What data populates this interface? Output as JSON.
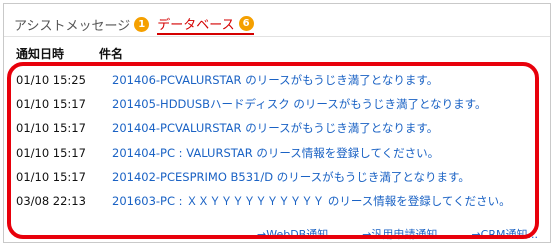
{
  "tabs": [
    {
      "label": "アシストメッセージ",
      "count": "1"
    },
    {
      "label": "データベース",
      "count": "6"
    }
  ],
  "table": {
    "headers": {
      "date": "通知日時",
      "subject": "件名"
    },
    "rows": [
      {
        "date": "01/10 15:25",
        "subject": "201406-PCVALURSTAR のリースがもうじき満了となります。"
      },
      {
        "date": "01/10 15:17",
        "subject": "201405-HDDUSBハードディスク のリースがもうじき満了となります。"
      },
      {
        "date": "01/10 15:17",
        "subject": "201404-PCVALURSTAR のリースがもうじき満了となります。"
      },
      {
        "date": "01/10 15:17",
        "subject": "201404-PC : VALURSTAR のリース情報を登録してください。"
      },
      {
        "date": "01/10 15:17",
        "subject": "201402-PCESPRIMO B531/D のリースがもうじき満了となります。"
      },
      {
        "date": "03/08 22:13",
        "subject": "201603-PC : ＸＸＹＹＹＹＹＹＹＹＹＹ のリース情報を登録してください。"
      }
    ]
  },
  "footer_links": [
    "→WebDB通知...",
    "→汎用申請通知...",
    "→CRM通知..."
  ],
  "colors": {
    "accent": "#d40000",
    "badge": "#f5a000",
    "link": "#1a62c4",
    "highlight": "#e8000b"
  }
}
